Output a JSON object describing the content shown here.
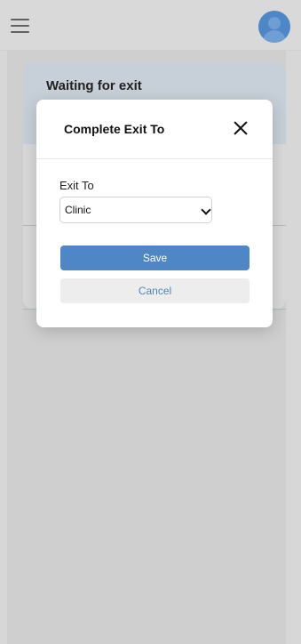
{
  "header": {
    "menu_icon": "hamburger-menu-icon",
    "avatar_icon": "user-avatar-icon"
  },
  "background_card": {
    "title": "Waiting for exit"
  },
  "modal": {
    "title": "Complete Exit To",
    "close_icon": "close-icon",
    "field_label": "Exit To",
    "selected_value": "Clinic",
    "save_label": "Save",
    "cancel_label": "Cancel"
  },
  "colors": {
    "accent": "#4f86c6",
    "overlay": "#d7d7d7",
    "card": "#c7cfd8",
    "modal": "#ffffff"
  }
}
